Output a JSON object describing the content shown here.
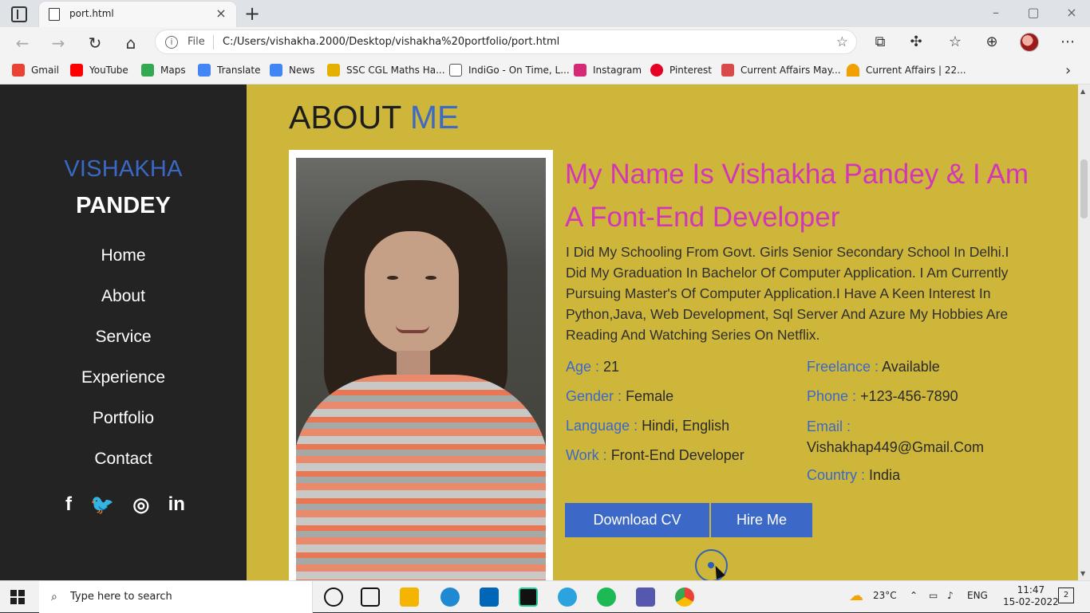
{
  "browser": {
    "tab_title": "port.html",
    "address_prefix": "File",
    "url": "C:/Users/vishakha.2000/Desktop/vishakha%20portfolio/port.html",
    "bookmarks": [
      "Gmail",
      "YouTube",
      "Maps",
      "Translate",
      "News",
      "SSC CGL Maths Ha...",
      "IndiGo - On Time, L...",
      "Instagram",
      "Pinterest",
      "Current Affairs May...",
      "Current Affairs | 22..."
    ]
  },
  "sidebar": {
    "name_first": "VISHAKHA",
    "name_last": "PANDEY",
    "nav": [
      "Home",
      "About",
      "Service",
      "Experience",
      "Portfolio",
      "Contact"
    ],
    "social_icons": [
      "facebook-icon",
      "twitter-icon",
      "instagram-icon",
      "linkedin-icon"
    ]
  },
  "about": {
    "title_main": "ABOUT",
    "title_accent": "ME",
    "intro": "My Name Is Vishakha Pandey & I Am A Font-End Developer",
    "bio": "I Did My Schooling From Govt. Girls Senior Secondary School In Delhi.I Did My Graduation In Bachelor Of Computer Application. I Am Currently Pursuing Master's Of Computer Application.I Have A Keen Interest In Python,Java, Web Development, Sql Server And Azure My Hobbies Are Reading And Watching Series On Netflix.",
    "left": [
      {
        "label": "Age :",
        "value": "21"
      },
      {
        "label": "Gender :",
        "value": "Female"
      },
      {
        "label": "Language :",
        "value": "Hindi, English"
      },
      {
        "label": "Work :",
        "value": "Front-End Developer"
      }
    ],
    "right": [
      {
        "label": "Freelance :",
        "value": "Available"
      },
      {
        "label": "Phone :",
        "value": "+123-456-7890"
      },
      {
        "label": "Email :",
        "value": "Vishakhap449@Gmail.Com"
      },
      {
        "label": "Country :",
        "value": "India"
      }
    ],
    "buttons": [
      "Download CV",
      "Hire Me"
    ]
  },
  "taskbar": {
    "search_placeholder": "Type here to search",
    "weather": "23°C",
    "language": "ENG",
    "time": "11:47",
    "date": "15-02-2022",
    "notifications": "2"
  },
  "colors": {
    "sidebar": "#232323",
    "main_bg": "#ceb63a",
    "accent": "#3d6ac4",
    "headline": "#d238b6"
  }
}
